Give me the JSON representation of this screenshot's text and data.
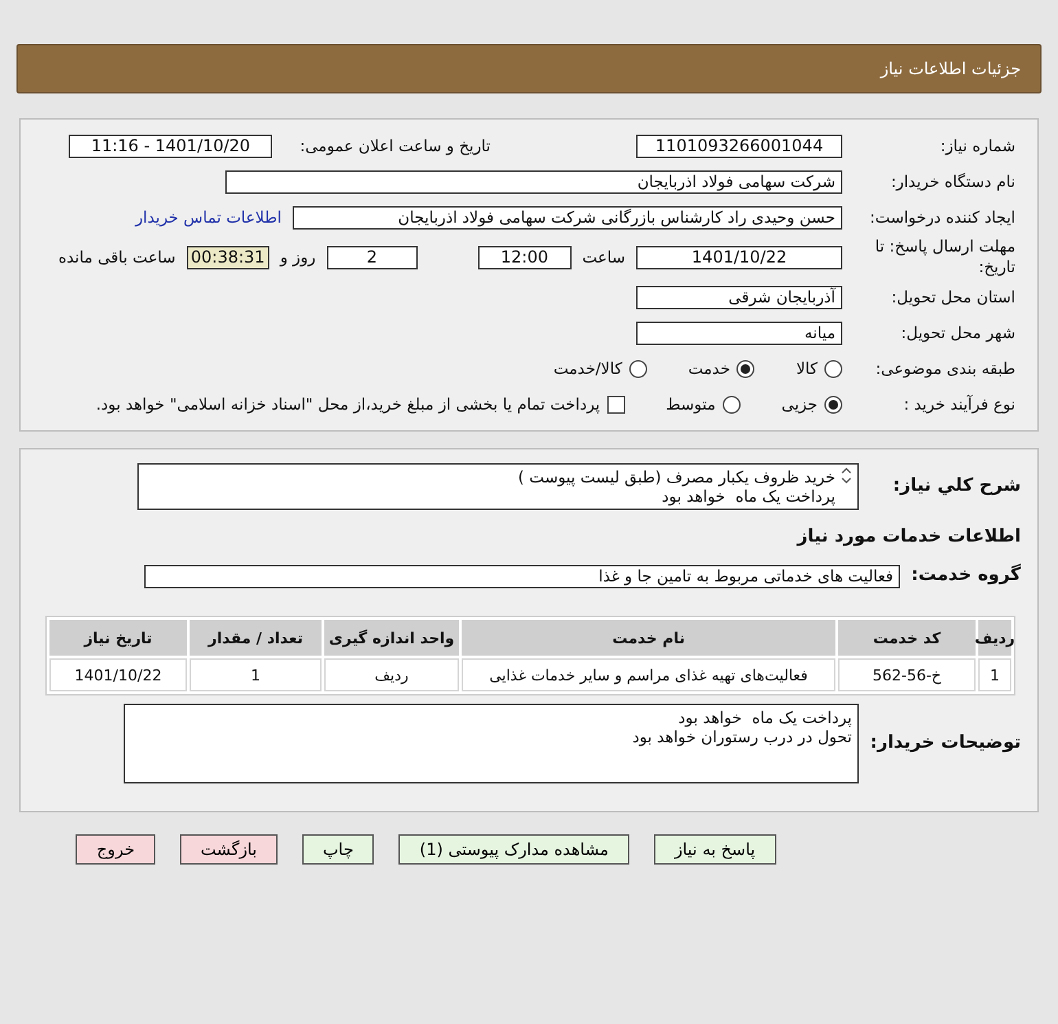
{
  "header": {
    "title": "جزئیات اطلاعات نیاز"
  },
  "need_number": {
    "label": "شماره نیاز:",
    "value": "1101093266001044"
  },
  "announce": {
    "label": "تاریخ و ساعت اعلان عمومی:",
    "value": "1401/10/20 - 11:16"
  },
  "buyer_org": {
    "label": "نام دستگاه خریدار:",
    "value": "شرکت سهامی فولاد اذربایجان"
  },
  "requester": {
    "label": "ایجاد کننده درخواست:",
    "value": "حسن وحیدی راد کارشناس بازرگانی شرکت سهامی فولاد اذربایجان",
    "link": "اطلاعات تماس خریدار"
  },
  "deadline": {
    "label": "مهلت ارسال پاسخ: تا تاریخ:",
    "date": "1401/10/22",
    "time_label": "ساعت",
    "time": "12:00",
    "days": "2",
    "days_label": "روز و",
    "remaining": "00:38:31",
    "remaining_label": "ساعت باقی مانده"
  },
  "province": {
    "label": "استان محل تحویل:",
    "value": "آذربایجان شرقی"
  },
  "city": {
    "label": "شهر محل تحویل:",
    "value": "میانه"
  },
  "category": {
    "label": "طبقه بندی موضوعی:",
    "options": [
      {
        "label": "کالا",
        "selected": false
      },
      {
        "label": "خدمت",
        "selected": true
      },
      {
        "label": "کالا/خدمت",
        "selected": false
      }
    ]
  },
  "process": {
    "label": "نوع فرآیند خرید :",
    "options": [
      {
        "label": "جزیی",
        "selected": true
      },
      {
        "label": "متوسط",
        "selected": false
      }
    ],
    "treasury": {
      "label": "پرداخت تمام یا بخشی از مبلغ خرید،از محل \"اسناد خزانه اسلامی\" خواهد بود.",
      "checked": false
    }
  },
  "description": {
    "label": "شرح کلي نياز:",
    "lines": [
      "خرید ظروف یکبار مصرف (طبق لیست پیوست )",
      "پرداخت یک ماه  خواهد بود"
    ]
  },
  "services_heading": "اطلاعات خدمات مورد نیاز",
  "service_group": {
    "label": "گروه خدمت:",
    "value": "فعالیت های خدماتی مربوط به تامین جا و غذا"
  },
  "table": {
    "columns": [
      "ردیف",
      "کد خدمت",
      "نام خدمت",
      "واحد اندازه گیری",
      "تعداد / مقدار",
      "تاریخ نیاز"
    ],
    "rows": [
      [
        "1",
        "خ-56-562",
        "فعالیت‌های تهیه غذای مراسم و سایر خدمات غذایی",
        "ردیف",
        "1",
        "1401/10/22"
      ]
    ]
  },
  "buyer_notes": {
    "label": "توضیحات خریدار:",
    "lines": [
      "پرداخت یک ماه  خواهد بود",
      "تحول در درب رستوران خواهد بود"
    ]
  },
  "buttons": [
    {
      "label": "پاسخ به نیاز",
      "kind": "normal"
    },
    {
      "label": "مشاهده مدارک پیوستی (1)",
      "kind": "normal"
    },
    {
      "label": "چاپ",
      "kind": "normal"
    },
    {
      "label": "بازگشت",
      "kind": "danger"
    },
    {
      "label": "خروج",
      "kind": "danger"
    }
  ]
}
